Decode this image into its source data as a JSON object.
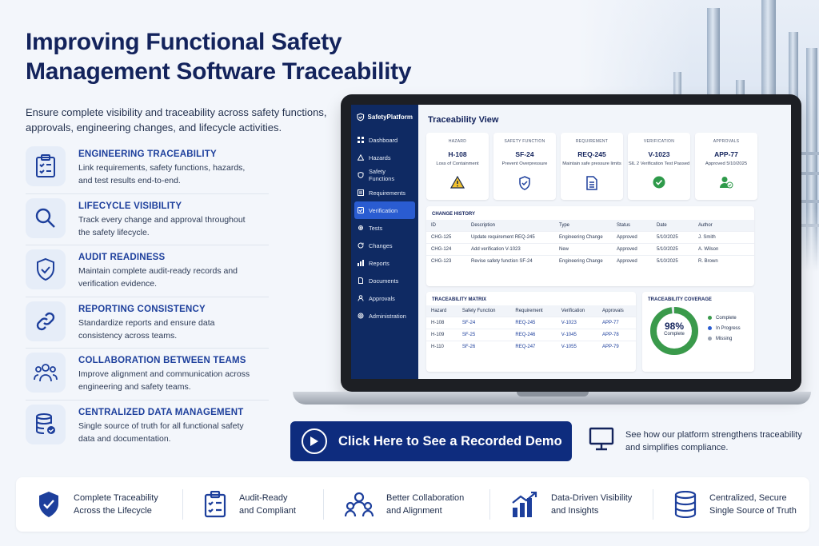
{
  "header": {
    "title": "Improving Functional Safety Management Software Traceability",
    "intro": "Ensure complete visibility and traceability across safety functions, approvals, engineering changes, and lifecycle activities."
  },
  "features": [
    {
      "title": "ENGINEERING TRACEABILITY",
      "desc": "Link requirements, safety functions, hazards, and test results end-to-end.",
      "icon": "clipboard-check-icon"
    },
    {
      "title": "LIFECYCLE VISIBILITY",
      "desc": "Track every change and approval throughout the safety lifecycle.",
      "icon": "magnifier-icon"
    },
    {
      "title": "AUDIT READINESS",
      "desc": "Maintain complete audit-ready records and verification evidence.",
      "icon": "shield-check-icon"
    },
    {
      "title": "REPORTING CONSISTENCY",
      "desc": "Standardize reports and ensure data consistency across teams.",
      "icon": "link-icon"
    },
    {
      "title": "COLLABORATION BETWEEN TEAMS",
      "desc": "Improve alignment and communication across engineering and safety teams.",
      "icon": "team-icon"
    },
    {
      "title": "CENTRALIZED DATA MANAGEMENT",
      "desc": "Single source of truth for all functional safety data and documentation.",
      "icon": "database-check-icon"
    }
  ],
  "app": {
    "brand": "SafetyPlatform",
    "nav": [
      {
        "label": "Dashboard",
        "active": false
      },
      {
        "label": "Hazards",
        "active": false
      },
      {
        "label": "Safety Functions",
        "active": false
      },
      {
        "label": "Requirements",
        "active": false
      },
      {
        "label": "Verification",
        "active": true
      },
      {
        "label": "Tests",
        "active": false
      },
      {
        "label": "Changes",
        "active": false
      },
      {
        "label": "Reports",
        "active": false
      },
      {
        "label": "Documents",
        "active": false
      },
      {
        "label": "Approvals",
        "active": false
      },
      {
        "label": "Administration",
        "active": false
      }
    ],
    "view_title": "Traceability View",
    "cards": [
      {
        "kind": "HAZARD",
        "id": "H-108",
        "sub": "Loss of Containment",
        "icon": "warning-icon"
      },
      {
        "kind": "SAFETY FUNCTION",
        "id": "SF-24",
        "sub": "Prevent Overpressure",
        "icon": "shield-icon"
      },
      {
        "kind": "REQUIREMENT",
        "id": "REQ-245",
        "sub": "Maintain safe pressure limits",
        "icon": "document-icon"
      },
      {
        "kind": "VERIFICATION",
        "id": "V-1023",
        "sub": "SIL 2 Verification Test Passed",
        "icon": "check-circle-icon"
      },
      {
        "kind": "APPROVALS",
        "id": "APP-77",
        "sub": "Approved 5/10/2025",
        "icon": "user-approved-icon"
      }
    ],
    "change_history": {
      "title": "CHANGE HISTORY",
      "columns": [
        "ID",
        "Description",
        "Type",
        "Status",
        "Date",
        "Author"
      ],
      "rows": [
        [
          "CHG-125",
          "Update requirement REQ-245",
          "Engineering Change",
          "Approved",
          "5/10/2025",
          "J. Smith"
        ],
        [
          "CHG-124",
          "Add verification V-1023",
          "New",
          "Approved",
          "5/10/2025",
          "A. Wilson"
        ],
        [
          "CHG-123",
          "Revise safety function SF-24",
          "Engineering Change",
          "Approved",
          "5/10/2025",
          "R. Brown"
        ]
      ]
    },
    "matrix": {
      "title": "TRACEABILITY MATRIX",
      "columns": [
        "Hazard",
        "Safety Function",
        "Requirement",
        "Verification",
        "Approvals"
      ],
      "rows": [
        [
          "H-108",
          "SF-24",
          "REQ-245",
          "V-1023",
          "APP-77"
        ],
        [
          "H-109",
          "SF-25",
          "REQ-246",
          "V-1045",
          "APP-78"
        ],
        [
          "H-110",
          "SF-26",
          "REQ-247",
          "V-1055",
          "APP-79"
        ]
      ]
    },
    "coverage": {
      "title": "TRACEABILITY COVERAGE",
      "value": "98%",
      "value_label": "Complete",
      "fraction": 0.98,
      "legend": [
        {
          "label": "Complete",
          "color": "#3a9a4b"
        },
        {
          "label": "In Progress",
          "color": "#2a5cd1"
        },
        {
          "label": "Missing",
          "color": "#9aa3b2"
        }
      ]
    }
  },
  "cta": {
    "label": "Click Here to See a Recorded Demo",
    "note": "See how our platform strengthens traceability and simplifies compliance."
  },
  "benefits": [
    {
      "text1": "Complete Traceability",
      "text2": "Across the Lifecycle",
      "icon": "shield-check-icon"
    },
    {
      "text1": "Audit-Ready",
      "text2": "and Compliant",
      "icon": "clipboard-check-icon"
    },
    {
      "text1": "Better Collaboration",
      "text2": "and Alignment",
      "icon": "team-icon"
    },
    {
      "text1": "Data-Driven Visibility",
      "text2": "and Insights",
      "icon": "bar-chart-icon"
    },
    {
      "text1": "Centralized, Secure",
      "text2": "Single Source of Truth",
      "icon": "database-icon"
    }
  ],
  "colors": {
    "accent": "#1d3f9c",
    "navy": "#0e2c7e",
    "sidebar": "#0f2a63",
    "success": "#3a9a4b"
  }
}
